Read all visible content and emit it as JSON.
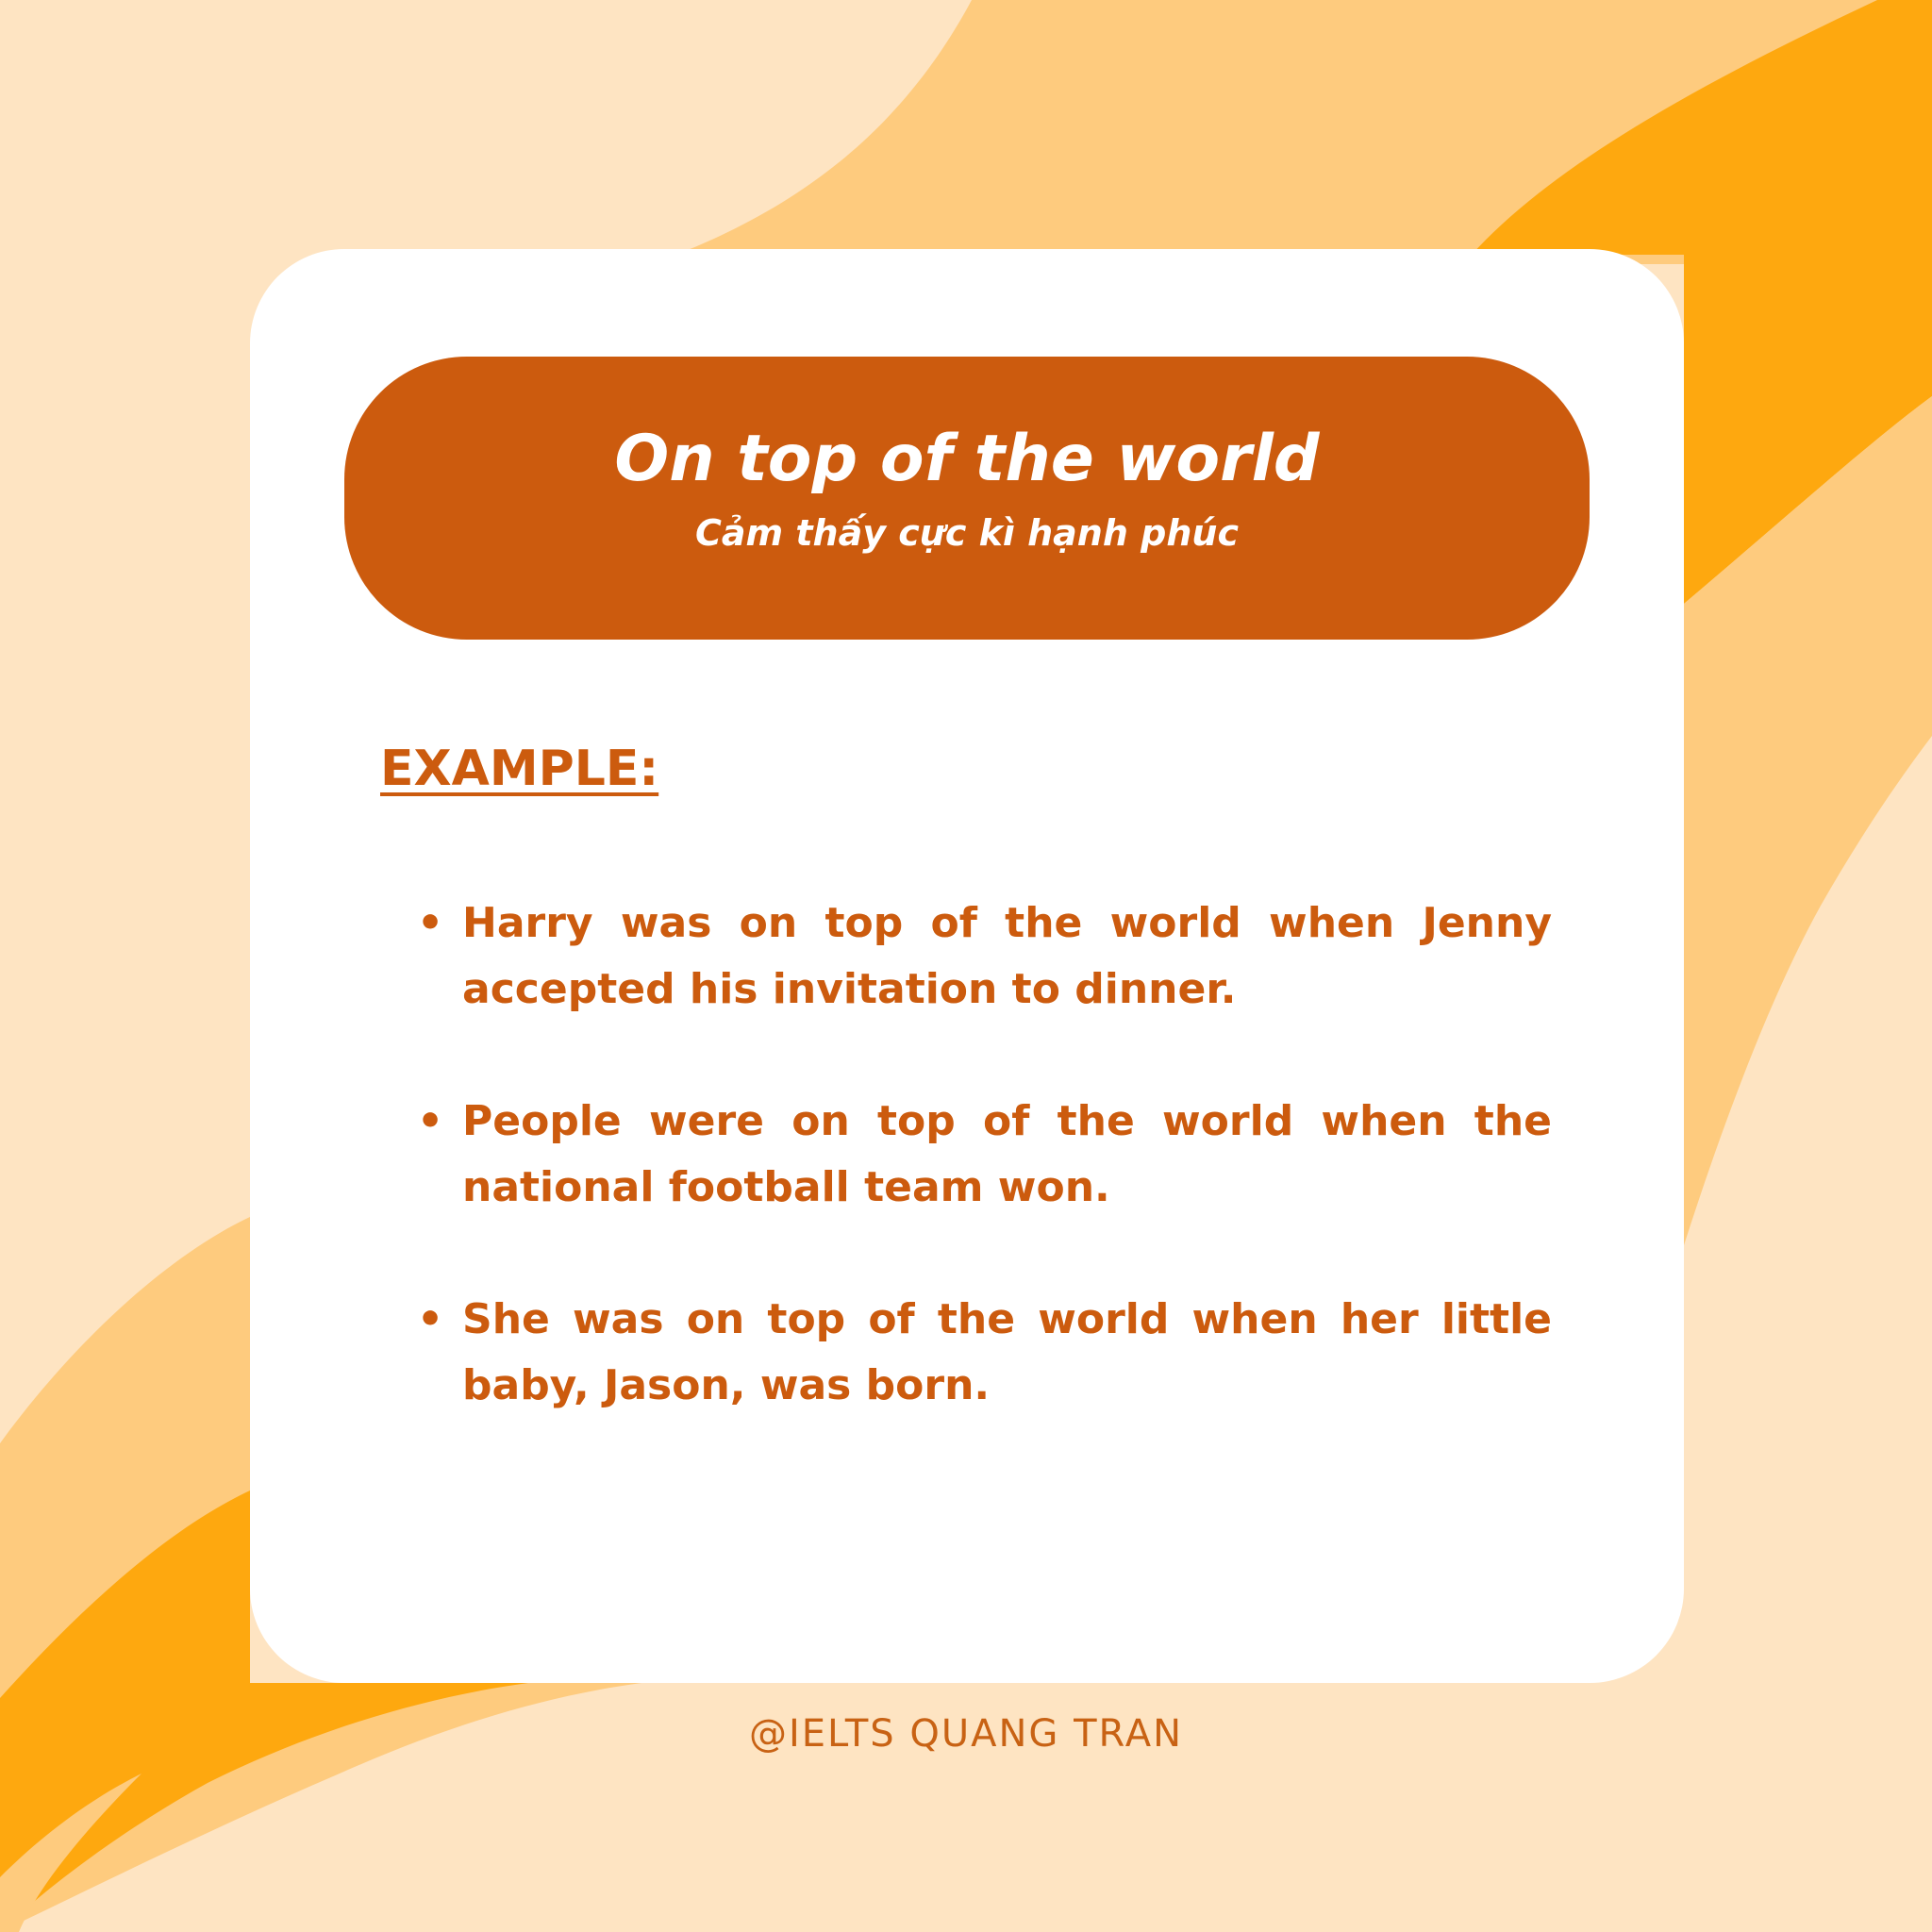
{
  "card": {
    "title": "On top of the world",
    "subtitle": "Cảm thấy cực kì hạnh phúc",
    "example_heading": "EXAMPLE:",
    "bullet_glyph": "•",
    "examples": [
      "Harry was on top of the world when Jenny accepted his invitation to dinner.",
      "People were on top of the world when the national football team won.",
      "She was on top of the world when her little baby, Jason, was born."
    ]
  },
  "footer": {
    "credit": "@IELTS QUANG TRAN"
  },
  "colors": {
    "background": "#FEE4C2",
    "wave_light": "#FECB7E",
    "wave_orange": "#FEA80F",
    "banner": "#CC5B0E",
    "text_accent": "#CC5B0E",
    "card": "#FFFFFF"
  }
}
